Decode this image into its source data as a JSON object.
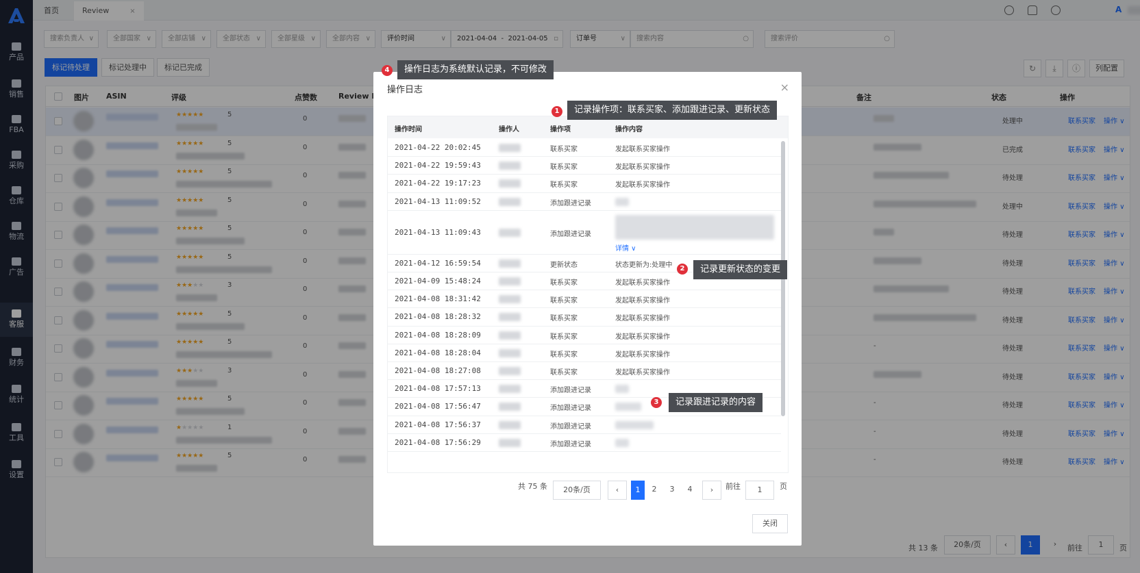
{
  "app": {
    "logo_letter": "A"
  },
  "sidebar": {
    "items": [
      {
        "label": "产品"
      },
      {
        "label": "销售"
      },
      {
        "label": "FBA"
      },
      {
        "label": "采购"
      },
      {
        "label": "仓库"
      },
      {
        "label": "物流"
      },
      {
        "label": "广告"
      },
      {
        "label": "客服"
      },
      {
        "label": "财务"
      },
      {
        "label": "统计"
      },
      {
        "label": "工具"
      },
      {
        "label": "设置"
      }
    ],
    "active_index": 7
  },
  "tabs": [
    {
      "label": "首页"
    },
    {
      "label": "Review",
      "close": "×"
    }
  ],
  "filters": {
    "owner": "搜索负责人",
    "country": "全部国家",
    "store": "全部店铺",
    "status": "全部状态",
    "level": "全部星级",
    "content": "全部内容",
    "review_time": "评价时间",
    "date_start": "2021-04-04",
    "date_sep": "-",
    "date_end": "2021-04-05",
    "order_type": "订单号",
    "search_placeholder": "搜索内容",
    "review_search_placeholder": "搜索评价"
  },
  "actions": {
    "mark_pending": "标记待处理",
    "mark_processing": "标记处理中",
    "mark_done": "标记已完成",
    "column_config": "列配置"
  },
  "table": {
    "headers": [
      "图片",
      "ASIN",
      "评级",
      "点赞数",
      "Review I",
      "备注",
      "状态",
      "操作"
    ],
    "rows": [
      {
        "rating": 5,
        "likes": "0",
        "status": "处理中",
        "note": ""
      },
      {
        "rating": 5,
        "likes": "0",
        "status": "已完成",
        "note": ""
      },
      {
        "rating": 5,
        "likes": "0",
        "status": "待处理",
        "note": ""
      },
      {
        "rating": 5,
        "likes": "0",
        "status": "处理中",
        "note": ""
      },
      {
        "rating": 5,
        "likes": "0",
        "status": "待处理",
        "note": ""
      },
      {
        "rating": 5,
        "likes": "0",
        "status": "待处理",
        "note": ""
      },
      {
        "rating": 3,
        "likes": "0",
        "status": "待处理",
        "note": ""
      },
      {
        "rating": 5,
        "likes": "0",
        "status": "待处理",
        "note": ""
      },
      {
        "rating": 5,
        "likes": "0",
        "status": "待处理",
        "note": "-"
      },
      {
        "rating": 3,
        "likes": "0",
        "status": "待处理",
        "note": ""
      },
      {
        "rating": 5,
        "likes": "0",
        "status": "待处理",
        "note": "-"
      },
      {
        "rating": 1,
        "likes": "0",
        "status": "待处理",
        "note": "-"
      },
      {
        "rating": 5,
        "likes": "0",
        "status": "待处理",
        "note": "-"
      }
    ],
    "row_action_contact": "联系买家",
    "row_action_more": "操作"
  },
  "pager": {
    "total": "共 13 条",
    "page_size": "20条/页",
    "current": "1",
    "goto_label": "前往",
    "goto_value": "1",
    "page_unit": "页"
  },
  "modal": {
    "title": "操作日志",
    "close_icon": "×",
    "headers": [
      "操作时间",
      "操作人",
      "操作项",
      "操作内容"
    ],
    "rows": [
      {
        "time": "2021-04-22 20:02:45",
        "item": "联系买家",
        "content": "发起联系买家操作"
      },
      {
        "time": "2021-04-22 19:59:43",
        "item": "联系买家",
        "content": "发起联系买家操作"
      },
      {
        "time": "2021-04-22 19:17:23",
        "item": "联系买家",
        "content": "发起联系买家操作"
      },
      {
        "time": "2021-04-13 11:09:52",
        "item": "添加跟进记录",
        "content": ""
      },
      {
        "time": "2021-04-13 11:09:43",
        "item": "添加跟进记录",
        "content": ""
      },
      {
        "time": "2021-04-12 16:59:54",
        "item": "更新状态",
        "content": "状态更新为:处理中"
      },
      {
        "time": "2021-04-09 15:48:24",
        "item": "联系买家",
        "content": "发起联系买家操作"
      },
      {
        "time": "2021-04-08 18:31:42",
        "item": "联系买家",
        "content": "发起联系买家操作"
      },
      {
        "time": "2021-04-08 18:28:32",
        "item": "联系买家",
        "content": "发起联系买家操作"
      },
      {
        "time": "2021-04-08 18:28:09",
        "item": "联系买家",
        "content": "发起联系买家操作"
      },
      {
        "time": "2021-04-08 18:28:04",
        "item": "联系买家",
        "content": "发起联系买家操作"
      },
      {
        "time": "2021-04-08 18:27:08",
        "item": "联系买家",
        "content": "发起联系买家操作"
      },
      {
        "time": "2021-04-08 17:57:13",
        "item": "添加跟进记录",
        "content": ""
      },
      {
        "time": "2021-04-08 17:56:47",
        "item": "添加跟进记录",
        "content": ""
      },
      {
        "time": "2021-04-08 17:56:37",
        "item": "添加跟进记录",
        "content": ""
      },
      {
        "time": "2021-04-08 17:56:29",
        "item": "添加跟进记录",
        "content": ""
      }
    ],
    "detail_link": "详情 ∨",
    "pager": {
      "total": "共 75 条",
      "page_size": "20条/页",
      "pages": [
        "1",
        "2",
        "3",
        "4"
      ],
      "current": "1",
      "goto_label": "前往",
      "goto_value": "1",
      "page_unit": "页"
    },
    "close_button": "关闭"
  },
  "callouts": [
    {
      "num": "1",
      "text": "记录操作项：联系买家、添加跟进记录、更新状态"
    },
    {
      "num": "2",
      "text": "记录更新状态的变更"
    },
    {
      "num": "3",
      "text": "记录跟进记录的内容"
    },
    {
      "num": "4",
      "text": "操作日志为系统默认记录，不可修改"
    }
  ],
  "colors": {
    "sidebar_bg": "#1d2535",
    "primary": "#1f6fff",
    "badge": "#e0303a",
    "callout_bg": "#4a4d52",
    "star": "#f5a623"
  }
}
